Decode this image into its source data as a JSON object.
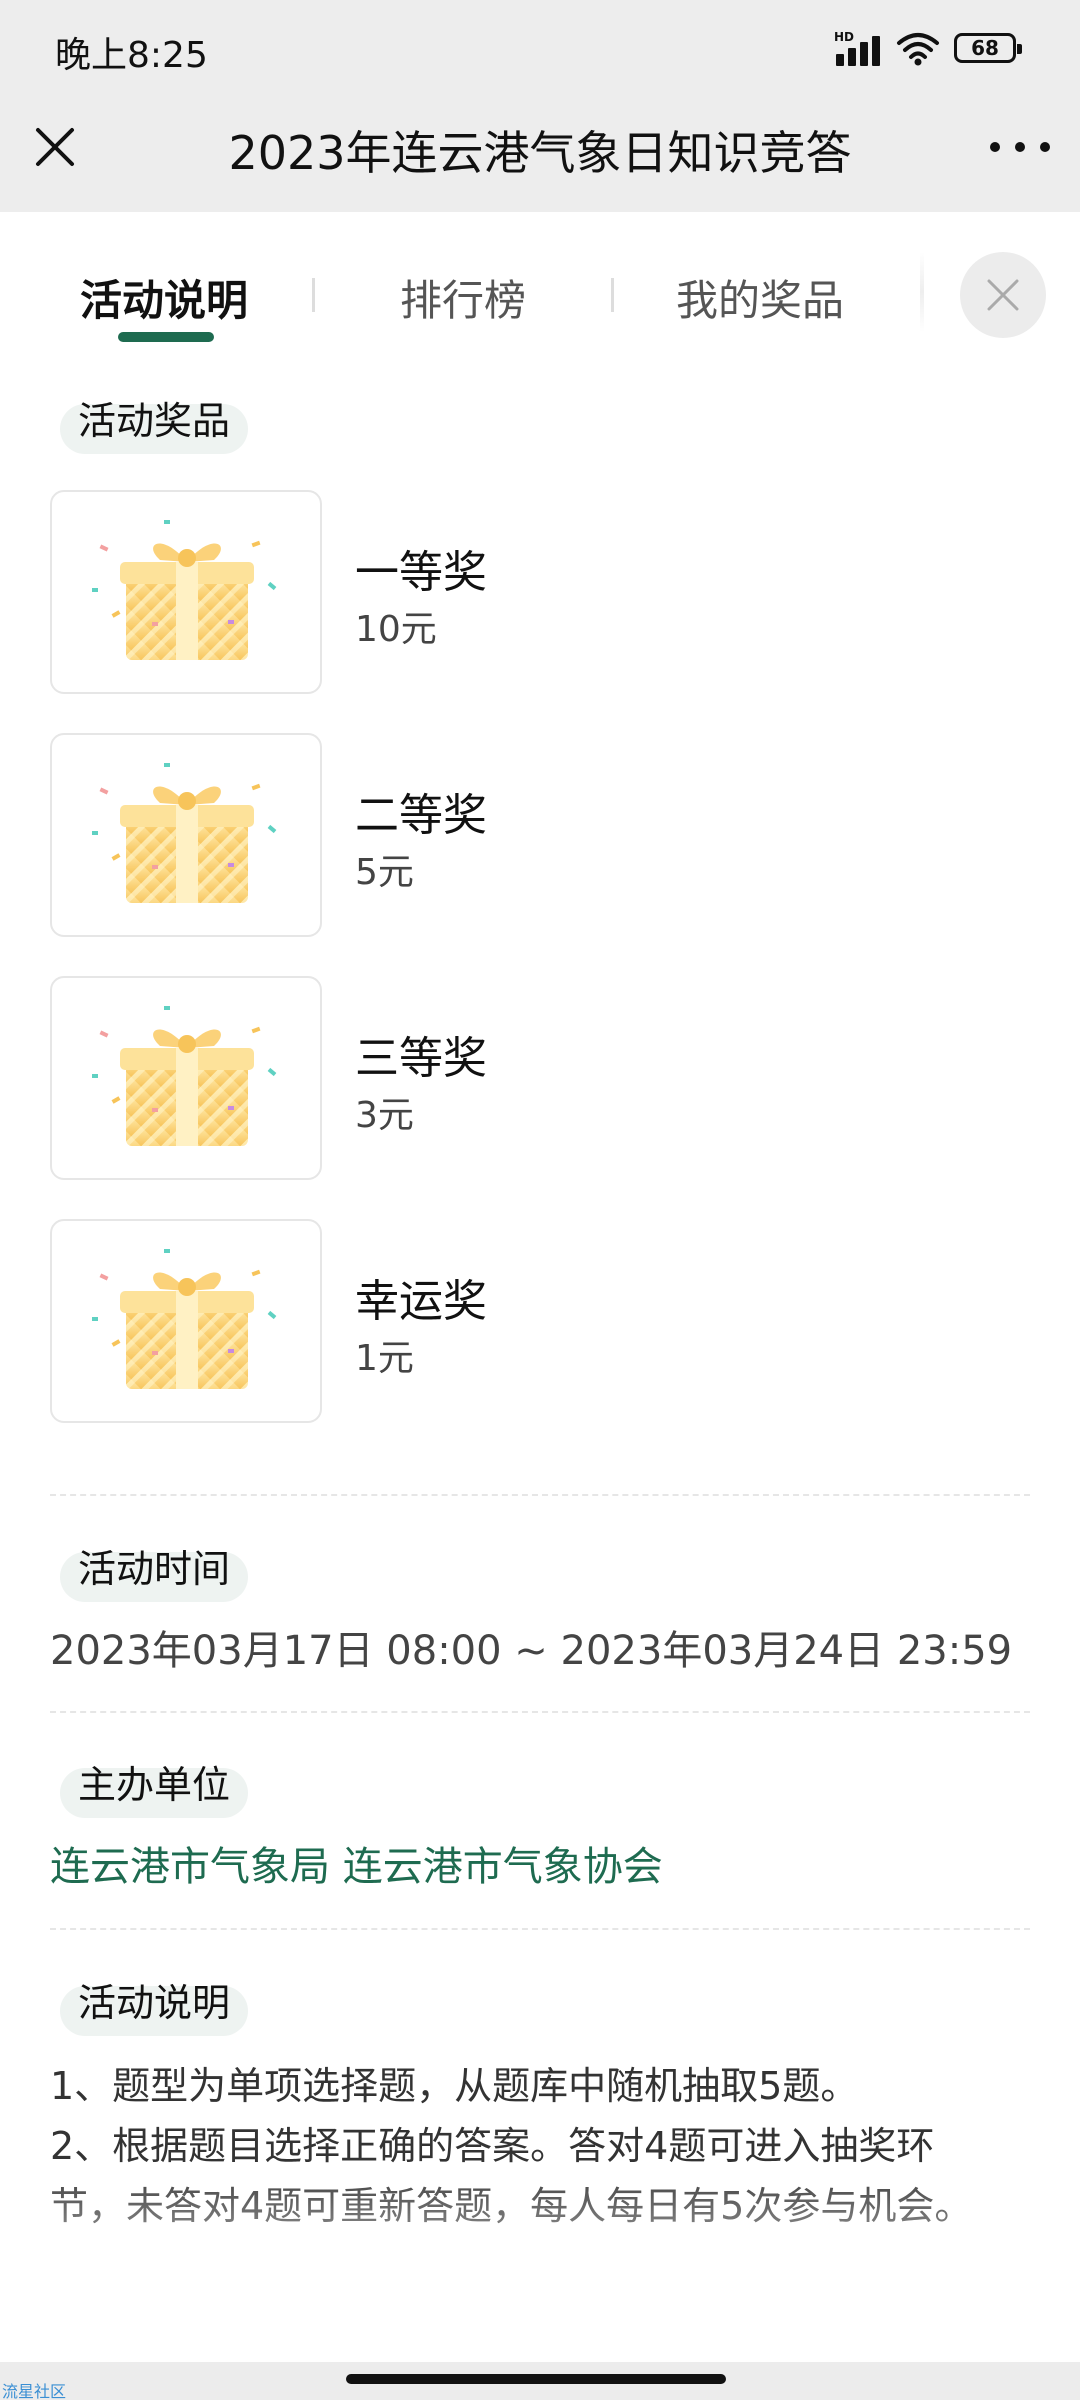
{
  "status_bar": {
    "time": "晚上8:25",
    "battery": "68"
  },
  "header": {
    "title": "2023年连云港气象日知识竞答"
  },
  "tabs": [
    {
      "label": "活动说明",
      "active": true
    },
    {
      "label": "排行榜",
      "active": false
    },
    {
      "label": "我的奖品",
      "active": false
    }
  ],
  "prizes_section": {
    "label": "活动奖品",
    "items": [
      {
        "name": "一等奖",
        "value": "10元"
      },
      {
        "name": "二等奖",
        "value": "5元"
      },
      {
        "name": "三等奖",
        "value": "3元"
      },
      {
        "name": "幸运奖",
        "value": "1元"
      }
    ]
  },
  "time_section": {
    "label": "活动时间",
    "text": "2023年03月17日 08:00 ~ 2023年03月24日 23:59"
  },
  "organizer_section": {
    "label": "主办单位",
    "text": "连云港市气象局 连云港市气象协会"
  },
  "description_section": {
    "label": "活动说明",
    "lines": [
      "1、题型为单项选择题，从题库中随机抽取5题。",
      "2、根据题目选择正确的答案。答对4题可进入抽奖环节，未答对4题可重新答题，每人每日有5次参与机会。"
    ]
  },
  "footer": {
    "corner_text": "流星社区"
  },
  "colors": {
    "accent": "#1e6b50",
    "header_bg": "#ededed",
    "pill_bg": "#eef3f1"
  }
}
